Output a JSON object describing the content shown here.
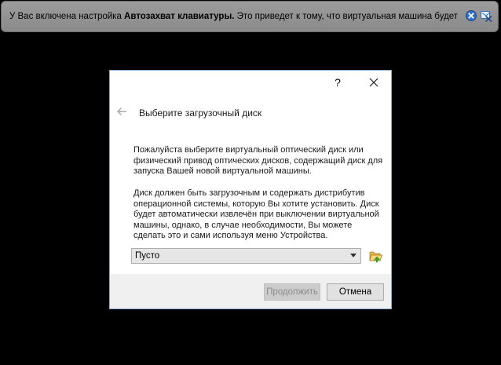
{
  "notification": {
    "text_before": "У Вас включена настройка ",
    "text_bold": "Автозахват клавиатуры.",
    "text_after": " Это приведет к тому, что виртуальная машина будет"
  },
  "dialog": {
    "help_label": "?",
    "title": "Выберите загрузочный диск",
    "paragraph1": "Пожалуйста выберите виртуальный оптический диск или физический привод оптических дисков, содержащий диск для запуска Вашей новой виртуальной машины.",
    "paragraph2": "Диск должен быть загрузочным и содержать дистрибутив операционной системы, которую Вы хотите установить. Диск будет автоматически извлечён при выключении виртуальной машины, однако, в случае необходимости, Вы можете сделать это и сами используя меню Устройства.",
    "combo_value": "Пусто",
    "continue_label": "Продолжить",
    "cancel_label": "Отмена"
  },
  "icons": {
    "notice_close": "close-circle-icon",
    "notice_dismiss": "dismiss-message-icon",
    "dialog_close": "close-icon",
    "back": "back-arrow-icon",
    "dropdown": "chevron-down-icon",
    "folder": "folder-open-icon"
  },
  "colors": {
    "vm_background": "#000000",
    "notice_bar": "#949494",
    "dialog_border": "#8aa6d6",
    "footer": "#f0f0f0"
  }
}
